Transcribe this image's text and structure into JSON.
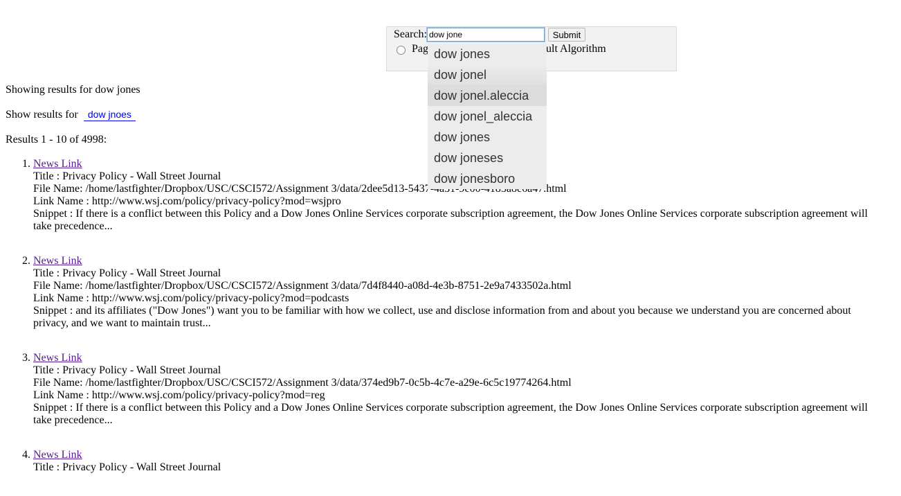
{
  "search": {
    "label": "Search:",
    "query": "dow jone",
    "submit_label": "Submit",
    "radio_pagerank_label": "Pag",
    "radio_default_label": "ult Algorithm"
  },
  "autocomplete": {
    "items": [
      "dow jones",
      "dow jonel",
      "dow jonel.aleccia",
      "dow jonel_aleccia",
      "dow jones",
      "dow joneses",
      "dow jonesboro"
    ]
  },
  "summary": {
    "showing_text": "Showing results for dow jones",
    "show_for_prefix": "Show results for",
    "suggestion": "dow jnoes",
    "results_count": "Results 1 - 10 of 4998:"
  },
  "results": [
    {
      "link": "News Link",
      "title": "Title : Privacy Policy - Wall Street Journal",
      "file": "File Name: /home/lastfighter/Dropbox/USC/CSCI572/Assignment 3/data/2dee5d13-5437-4a31-9e00-4185a8e6a47.html",
      "url": "Link Name : http://www.wsj.com/policy/privacy-policy?mod=wsjpro",
      "snippet": "Snippet : If there is a conflict between this Policy and a Dow Jones Online Services corporate subscription agreement, the Dow Jones Online Services corporate subscription agreement will take precedence..."
    },
    {
      "link": "News Link",
      "title": "Title : Privacy Policy - Wall Street Journal",
      "file": "File Name: /home/lastfighter/Dropbox/USC/CSCI572/Assignment 3/data/7d4f8440-a08d-4e3b-8751-2e9a7433502a.html",
      "url": "Link Name : http://www.wsj.com/policy/privacy-policy?mod=podcasts",
      "snippet": "Snippet : and its affiliates (\"Dow Jones\") want you to be familiar with how we collect, use and disclose information from and about you because we understand you are concerned about privacy, and we want to maintain trust..."
    },
    {
      "link": "News Link",
      "title": "Title : Privacy Policy - Wall Street Journal",
      "file": "File Name: /home/lastfighter/Dropbox/USC/CSCI572/Assignment 3/data/374ed9b7-0c5b-4c7e-a29e-6c5c19774264.html",
      "url": "Link Name : http://www.wsj.com/policy/privacy-policy?mod=reg",
      "snippet": "Snippet : If there is a conflict between this Policy and a Dow Jones Online Services corporate subscription agreement, the Dow Jones Online Services corporate subscription agreement will take precedence..."
    },
    {
      "link": "News Link",
      "title": "Title : Privacy Policy - Wall Street Journal",
      "file": "",
      "url": "",
      "snippet": ""
    }
  ]
}
